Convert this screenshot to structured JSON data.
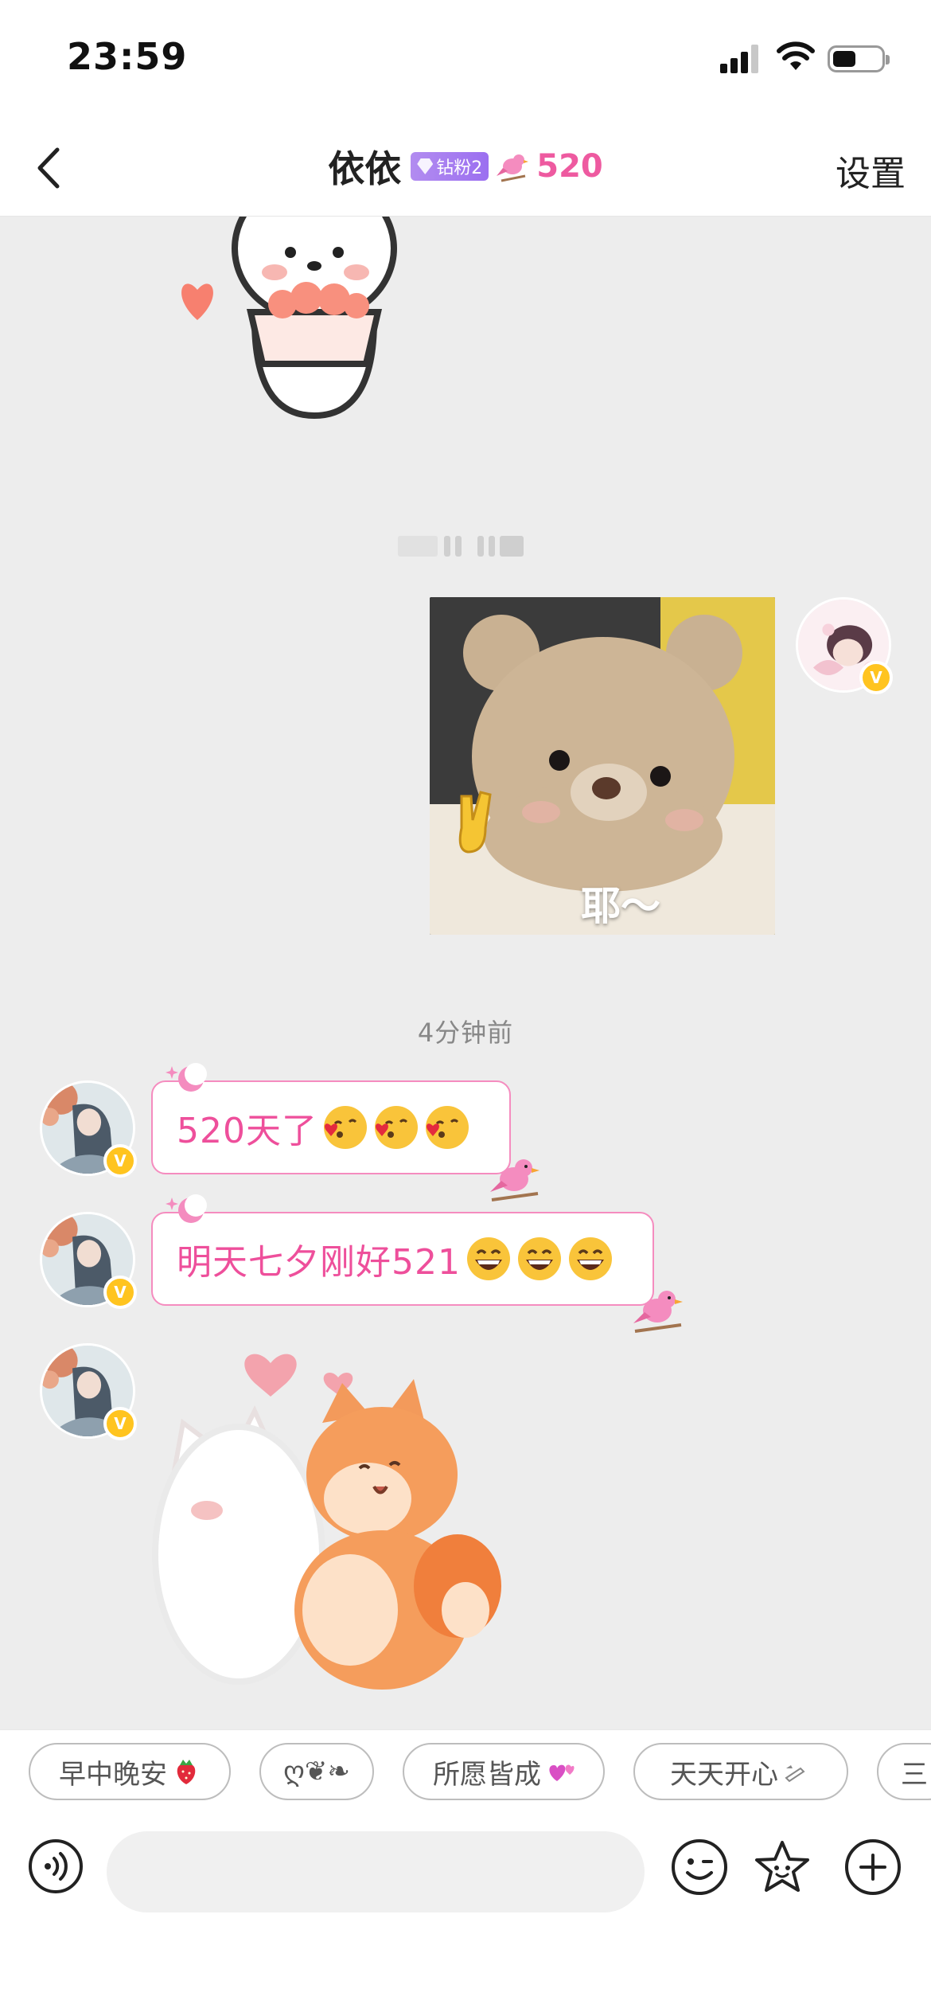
{
  "status_bar": {
    "time": "23:59"
  },
  "nav": {
    "contact_name": "依依",
    "fan_badge": "钻粉2",
    "intimacy_value": "520",
    "settings_label": "设置"
  },
  "chat": {
    "photo_caption": "耶～",
    "timestamp": "4分钟前",
    "messages": [
      {
        "text": "520天了",
        "emoji_count": 3,
        "emoji": "kissing-face-icon"
      },
      {
        "text": "明天七夕刚好521",
        "emoji_count": 3,
        "emoji": "grinning-face-icon"
      }
    ]
  },
  "quick_replies": [
    {
      "label": "早中晚安",
      "icon": "strawberry-icon"
    },
    {
      "label": "ღ❦❧",
      "icon": ""
    },
    {
      "label": "所愿皆成",
      "icon": "hearts-icon"
    },
    {
      "label": "天天开心",
      "icon": "pen-icon"
    },
    {
      "label": "三",
      "icon": ""
    }
  ],
  "input": {
    "placeholder": ""
  },
  "colors": {
    "accent_pink": "#ee4f9b",
    "bubble_border": "#f58cbf",
    "chat_bg": "#ededed",
    "badge_purple": "#a57ef0",
    "verified_yellow": "#ffc41f"
  }
}
